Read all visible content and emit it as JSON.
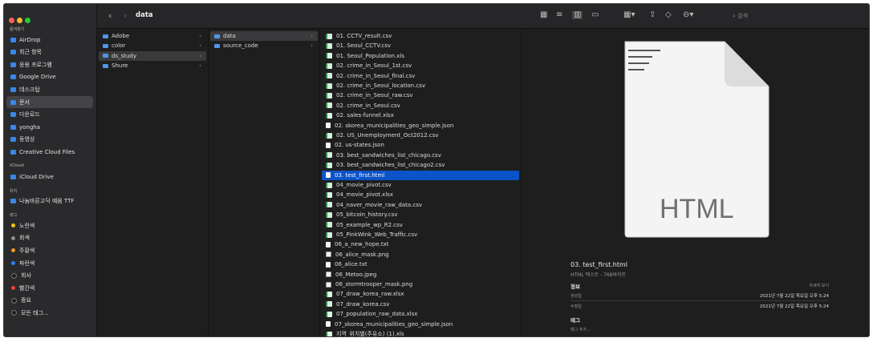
{
  "toolbar": {
    "title": "data",
    "search_placeholder": "검색"
  },
  "sidebar": {
    "sections": [
      {
        "header": "즐겨찾기",
        "items": [
          {
            "label": "AirDrop",
            "icon": "airdrop-icon"
          },
          {
            "label": "최근 항목",
            "icon": "clock-icon"
          },
          {
            "label": "응용 프로그램",
            "icon": "applications-icon"
          },
          {
            "label": "Google Drive",
            "icon": "folder-icon"
          },
          {
            "label": "데스크탑",
            "icon": "desktop-icon"
          },
          {
            "label": "문서",
            "icon": "document-icon",
            "selected": true
          },
          {
            "label": "다운로드",
            "icon": "download-icon"
          },
          {
            "label": "yongha",
            "icon": "home-icon"
          },
          {
            "label": "동영상",
            "icon": "movies-icon"
          },
          {
            "label": "Creative Cloud Files",
            "icon": "creative-cloud-icon"
          }
        ]
      },
      {
        "header": "iCloud",
        "items": [
          {
            "label": "iCloud Drive",
            "icon": "cloud-icon"
          }
        ]
      },
      {
        "header": "위치",
        "items": [
          {
            "label": "나눔바른고딕 예움 TTF",
            "icon": "disk-icon"
          }
        ]
      },
      {
        "header": "태그",
        "items": [
          {
            "label": "노란색",
            "color": "#f5c400"
          },
          {
            "label": "회색",
            "color": "#8e8e93"
          },
          {
            "label": "주황색",
            "color": "#f29a1f"
          },
          {
            "label": "파란색",
            "color": "#2f7ff0"
          },
          {
            "label": "회사",
            "color": "#1e1e1e"
          },
          {
            "label": "빨간색",
            "color": "#ef4136"
          },
          {
            "label": "중요",
            "color": "#1e1e1e"
          },
          {
            "label": "모든 태그...",
            "color": "#1e1e1e"
          }
        ]
      }
    ]
  },
  "col1": [
    "Adobe",
    "color",
    "ds_study",
    "Shure"
  ],
  "col2": [
    "data",
    "source_code"
  ],
  "files": [
    {
      "name": "01. CCTV_result.csv",
      "kind": "csv"
    },
    {
      "name": "01. Seoul_CCTV.csv",
      "kind": "csv"
    },
    {
      "name": "01. Seoul_Population.xls",
      "kind": "x"
    },
    {
      "name": "02. crime_in_Seoul_1st.csv",
      "kind": "csv"
    },
    {
      "name": "02. crime_in_Seoul_final.csv",
      "kind": "csv"
    },
    {
      "name": "02. crime_in_Seoul_location.csv",
      "kind": "csv"
    },
    {
      "name": "02. crime_in_Seoul_raw.csv",
      "kind": "csv"
    },
    {
      "name": "02. crime_in_Seoul.csv",
      "kind": "csv"
    },
    {
      "name": "02. sales-funnel.xlsx",
      "kind": "x"
    },
    {
      "name": "02. skorea_municipalities_geo_simple.json",
      "kind": "h"
    },
    {
      "name": "02. US_Unemployment_Oct2012.csv",
      "kind": "csv"
    },
    {
      "name": "02. us-states.json",
      "kind": "h"
    },
    {
      "name": "03. best_sandwiches_list_chicago.csv",
      "kind": "csv"
    },
    {
      "name": "03. best_sandwiches_list_chicago2.csv",
      "kind": "csv"
    },
    {
      "name": "03. test_first.html",
      "kind": "h",
      "selected": true
    },
    {
      "name": "04_movie_pivot.csv",
      "kind": "csv"
    },
    {
      "name": "04_movie_pivot.xlsx",
      "kind": "x"
    },
    {
      "name": "04_naver_movie_raw_data.csv",
      "kind": "csv"
    },
    {
      "name": "05_bitcoin_history.csv",
      "kind": "csv"
    },
    {
      "name": "05_example_wp_R2.csv",
      "kind": "csv"
    },
    {
      "name": "05_PinkWink_Web_Traffic.csv",
      "kind": "csv"
    },
    {
      "name": "06_a_new_hope.txt",
      "kind": "h"
    },
    {
      "name": "06_alice_mask.png",
      "kind": "img"
    },
    {
      "name": "06_alice.txt",
      "kind": "h"
    },
    {
      "name": "06_Metoo.jpeg",
      "kind": "img"
    },
    {
      "name": "06_stormtrooper_mask.png",
      "kind": "img"
    },
    {
      "name": "07_draw_korea_raw.xlsx",
      "kind": "x"
    },
    {
      "name": "07_draw_korea.csv",
      "kind": "csv"
    },
    {
      "name": "07_population_raw_data.xlsx",
      "kind": "x"
    },
    {
      "name": "07_skorea_municipalities_geo_simple.json",
      "kind": "h"
    },
    {
      "name": "지역_위치별(주유소) (1).xls",
      "kind": "x"
    }
  ],
  "preview": {
    "big_label": "HTML",
    "file_name": "03. test_first.html",
    "file_sub": "HTML 텍스트 - 768바이트",
    "info_header": "정보",
    "more": "자세히 보기",
    "created_label": "생성일",
    "created_value": "2021년 7월 22일 목요일 오후 5:24",
    "modified_label": "수정일",
    "modified_value": "2021년 7월 22일 목요일 오후 5:24",
    "tags_header": "태그",
    "tags_placeholder": "태그 추가..."
  },
  "colors": {
    "accent": "#0b53c9",
    "close": "#fe5f57",
    "min": "#febc2e",
    "max": "#28c840"
  }
}
